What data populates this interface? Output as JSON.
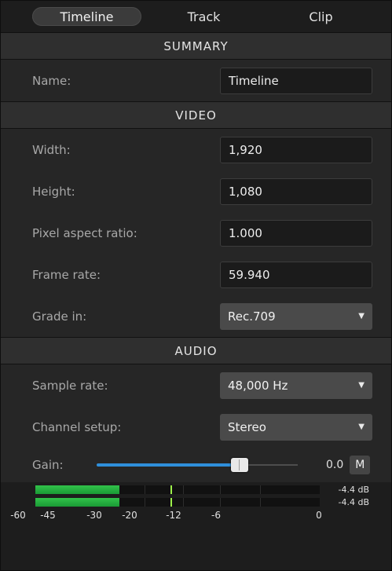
{
  "tabs": [
    {
      "label": "Timeline",
      "active": true
    },
    {
      "label": "Track",
      "active": false
    },
    {
      "label": "Clip",
      "active": false
    }
  ],
  "summary": {
    "header": "SUMMARY",
    "name_label": "Name:",
    "name_value": "Timeline"
  },
  "video": {
    "header": "VIDEO",
    "width_label": "Width:",
    "width_value": "1,920",
    "height_label": "Height:",
    "height_value": "1,080",
    "par_label": "Pixel aspect ratio:",
    "par_value": "1.000",
    "framerate_label": "Frame rate:",
    "framerate_value": "59.940",
    "grade_label": "Grade in:",
    "grade_value": "Rec.709"
  },
  "audio": {
    "header": "AUDIO",
    "samplerate_label": "Sample rate:",
    "samplerate_value": "48,000 Hz",
    "channel_label": "Channel setup:",
    "channel_value": "Stereo",
    "gain_label": "Gain:",
    "gain_value": "0.0",
    "gain_level": 0.71,
    "mute_label": "M"
  },
  "meters": {
    "channels": [
      {
        "level_db": "-4.4 dB",
        "fill": 0.295,
        "peak": 0.475
      },
      {
        "level_db": "-4.4 dB",
        "fill": 0.295,
        "peak": 0.475
      }
    ],
    "scale": [
      "-60",
      "-45",
      "-30",
      "-20",
      "-12",
      "-6",
      "0"
    ]
  },
  "colors": {
    "accent": "#2f8fdb",
    "meter_green": "#2cb845",
    "peak": "#9df04a"
  }
}
